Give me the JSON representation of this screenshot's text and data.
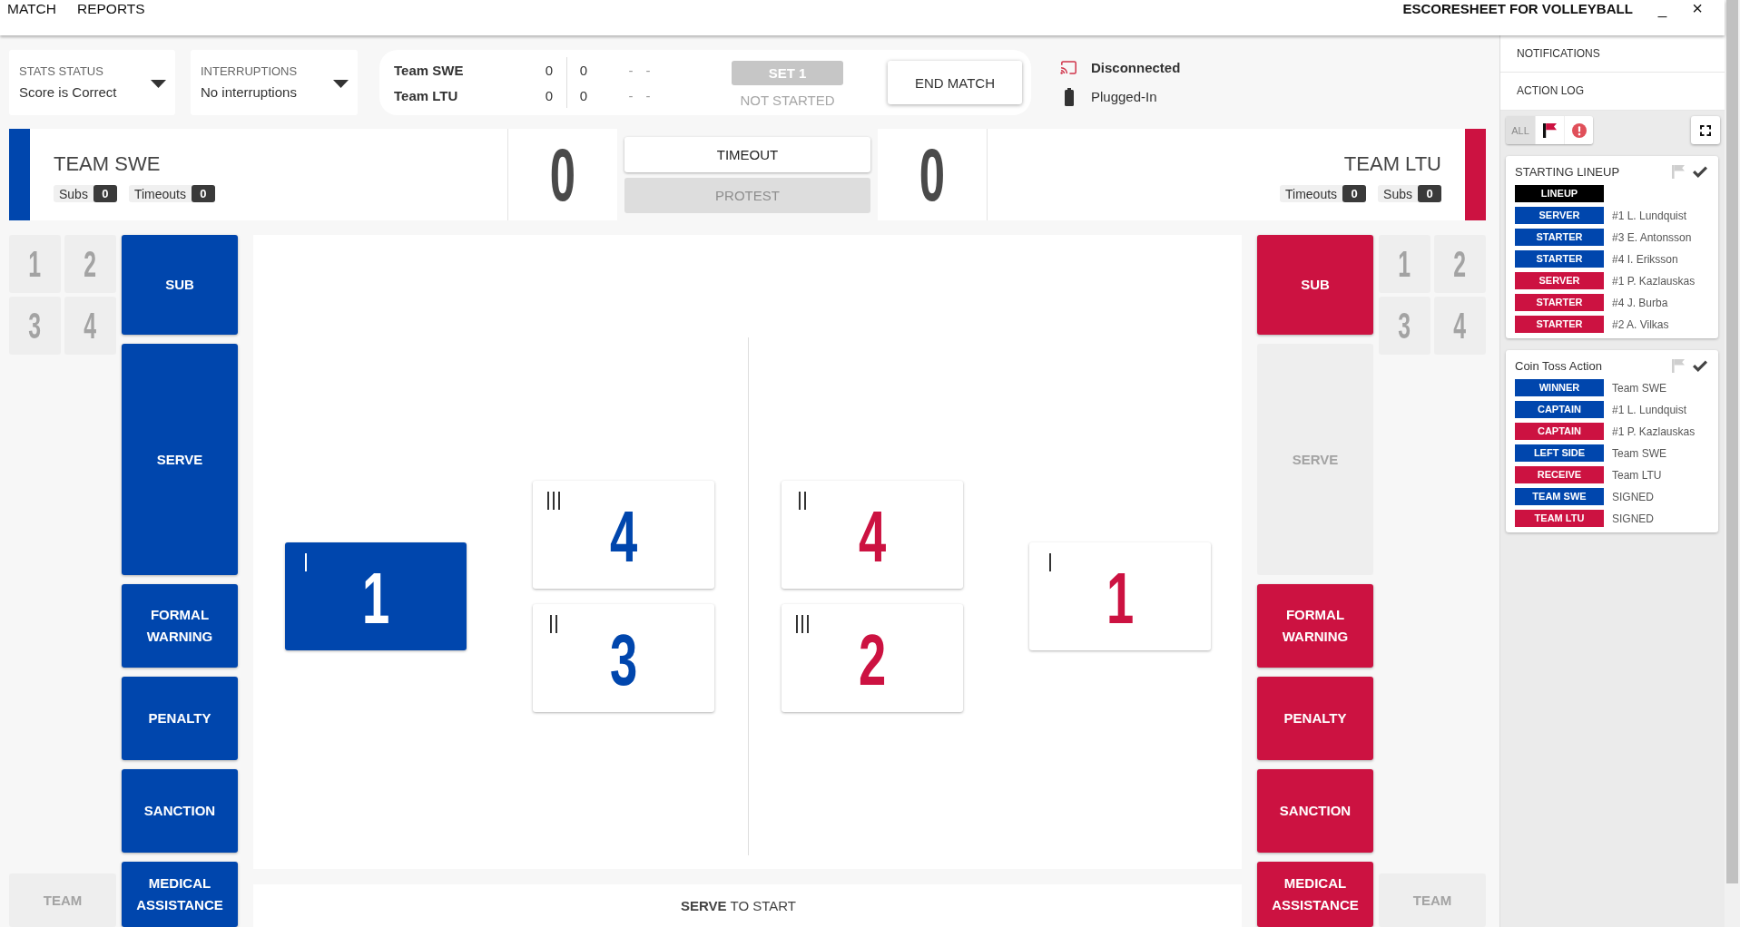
{
  "menu": [
    {
      "label": "MATCH"
    },
    {
      "label": "REPORTS"
    }
  ],
  "app_title": "ESCORESHEET FOR VOLLEYBALL",
  "window_controls": [
    {
      "kind": "minimize",
      "label": "_"
    },
    {
      "kind": "close",
      "label": "×"
    }
  ],
  "status": {
    "dropdowns": [
      {
        "label": "STATS STATUS",
        "value": "Score is Correct"
      },
      {
        "label": "INTERRUPTIONS",
        "value": "No interruptions"
      }
    ],
    "score_summary": {
      "rows": [
        {
          "team": "Team SWE",
          "cells": [
            "0",
            "0",
            "-",
            "-"
          ]
        },
        {
          "team": "Team LTU",
          "cells": [
            "0",
            "0",
            "-",
            "-"
          ]
        }
      ],
      "set_label": "SET 1",
      "set_state": "NOT STARTED"
    },
    "end_match": "END MATCH",
    "connection": {
      "label": "Disconnected",
      "connected": false
    },
    "power": {
      "label": "Plugged-In"
    }
  },
  "teams": [
    {
      "name": "TEAM SWE",
      "color": "#0046ad",
      "score": "0",
      "counters": [
        {
          "label": "Subs",
          "value": "0"
        },
        {
          "label": "Timeouts",
          "value": "0"
        }
      ],
      "bench": [
        {
          "label": "1",
          "disabled": true
        },
        {
          "label": "2",
          "disabled": true
        },
        {
          "label": "3",
          "disabled": true
        },
        {
          "label": "4",
          "disabled": true
        }
      ],
      "team_button": {
        "label": "TEAM",
        "disabled": true
      },
      "actions": [
        {
          "label": "SUB",
          "disabled": false
        },
        {
          "label": "SERVE",
          "disabled": false
        },
        {
          "label": "FORMAL WARNING",
          "disabled": false
        },
        {
          "label": "PENALTY",
          "disabled": false
        },
        {
          "label": "SANCTION",
          "disabled": false
        },
        {
          "label": "MEDICAL ASSISTANCE",
          "disabled": false
        }
      ],
      "court": [
        {
          "position": "I",
          "number": "1",
          "serving": true
        },
        {
          "position": "III",
          "number": "4",
          "serving": false
        },
        {
          "position": "II",
          "number": "3",
          "serving": false
        }
      ]
    },
    {
      "name": "TEAM LTU",
      "color": "#cc1241",
      "score": "0",
      "counters": [
        {
          "label": "Timeouts",
          "value": "0"
        },
        {
          "label": "Subs",
          "value": "0"
        }
      ],
      "bench": [
        {
          "label": "1",
          "disabled": true
        },
        {
          "label": "2",
          "disabled": true
        },
        {
          "label": "3",
          "disabled": true
        },
        {
          "label": "4",
          "disabled": true
        }
      ],
      "team_button": {
        "label": "TEAM",
        "disabled": true
      },
      "actions": [
        {
          "label": "SUB",
          "disabled": false
        },
        {
          "label": "SERVE",
          "disabled": true
        },
        {
          "label": "FORMAL WARNING",
          "disabled": false
        },
        {
          "label": "PENALTY",
          "disabled": false
        },
        {
          "label": "SANCTION",
          "disabled": false
        },
        {
          "label": "MEDICAL ASSISTANCE",
          "disabled": false
        }
      ],
      "court": [
        {
          "position": "I",
          "number": "1",
          "serving": false
        },
        {
          "position": "II",
          "number": "4",
          "serving": false
        },
        {
          "position": "III",
          "number": "2",
          "serving": false
        }
      ]
    }
  ],
  "center_buttons": [
    {
      "label": "TIMEOUT",
      "disabled": false
    },
    {
      "label": "PROTEST",
      "disabled": true
    }
  ],
  "serve_prompt": "**SERVE** TO START",
  "sidebar": {
    "tabs": [
      {
        "label": "NOTIFICATIONS"
      },
      {
        "label": "ACTION LOG"
      }
    ],
    "filters": [
      {
        "kind": "all",
        "label": "ALL",
        "selected": true
      },
      {
        "kind": "flagged",
        "selected": false
      },
      {
        "kind": "errors",
        "selected": false
      }
    ],
    "log": [
      {
        "title": "STARTING LINEUP",
        "flagged": false,
        "confirmed": true,
        "entries": [
          {
            "tag": "LINEUP",
            "color": "#000000"
          },
          {
            "tag": "SERVER",
            "color": "#0046ad",
            "text": "#1 L. Lundquist"
          },
          {
            "tag": "STARTER",
            "color": "#0046ad",
            "text": "#3 E. Antonsson"
          },
          {
            "tag": "STARTER",
            "color": "#0046ad",
            "text": "#4 I. Eriksson"
          },
          {
            "tag": "SERVER",
            "color": "#cc1241",
            "text": "#1 P. Kazlauskas"
          },
          {
            "tag": "STARTER",
            "color": "#cc1241",
            "text": "#4 J. Burba"
          },
          {
            "tag": "STARTER",
            "color": "#cc1241",
            "text": "#2 A. Vilkas"
          }
        ]
      },
      {
        "title": "Coin Toss Action",
        "flagged": false,
        "confirmed": true,
        "entries": [
          {
            "tag": "WINNER",
            "color": "#0046ad",
            "text": "Team SWE"
          },
          {
            "tag": "CAPTAIN",
            "color": "#0046ad",
            "text": "#1 L. Lundquist"
          },
          {
            "tag": "CAPTAIN",
            "color": "#cc1241",
            "text": "#1 P. Kazlauskas"
          },
          {
            "tag": "LEFT SIDE",
            "color": "#0046ad",
            "text": "Team SWE"
          },
          {
            "tag": "RECEIVE",
            "color": "#cc1241",
            "text": "Team LTU"
          },
          {
            "tag": "TEAM SWE",
            "color": "#0046ad",
            "text": "SIGNED"
          },
          {
            "tag": "TEAM LTU",
            "color": "#cc1241",
            "text": "SIGNED"
          }
        ]
      }
    ]
  }
}
